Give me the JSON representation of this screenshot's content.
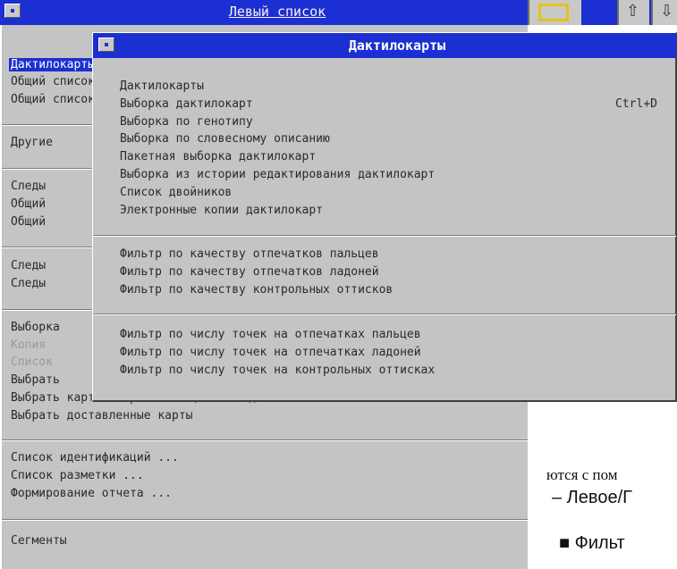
{
  "window": {
    "title": "Левый список"
  },
  "left_menu": {
    "items": [
      {
        "label": "Дактилокарты",
        "state": "selected"
      },
      {
        "label": "Общий список",
        "state": "normal"
      },
      {
        "label": "Общий список",
        "state": "normal"
      },
      {
        "label": "Другие",
        "state": "normal"
      },
      {
        "label": "Следы",
        "state": "normal"
      },
      {
        "label": "Общий",
        "state": "normal"
      },
      {
        "label": "Общий",
        "state": "normal"
      },
      {
        "label": "Следы",
        "state": "normal"
      },
      {
        "label": "Следы",
        "state": "normal"
      },
      {
        "label": "Выборка",
        "state": "normal"
      },
      {
        "label": "Копия",
        "state": "disabled"
      },
      {
        "label": "Список",
        "state": "disabled"
      },
      {
        "label": "Выбрать",
        "state": "normal"
      },
      {
        "label": "Выбрать карты отправленные, но не доставленные",
        "state": "normal"
      },
      {
        "label": "Выбрать доставленные карты",
        "state": "normal"
      },
      {
        "label": "Список идентификаций ...",
        "state": "normal"
      },
      {
        "label": "Список разметки ...",
        "state": "normal"
      },
      {
        "label": "Формирование отчета ...",
        "state": "normal"
      },
      {
        "label": "Сегменты",
        "state": "normal"
      }
    ]
  },
  "popup": {
    "title": "Дактилокарты",
    "items": [
      {
        "label": "Дактилокарты"
      },
      {
        "label": "Выборка дактилокарт",
        "shortcut": "Ctrl+D"
      },
      {
        "label": "Выборка по генотипу"
      },
      {
        "label": "Выборка по словесному описанию"
      },
      {
        "label": "Пакетная выборка дактилокарт"
      },
      {
        "label": "Выборка из истории редактирования дактилокарт"
      },
      {
        "label": "Список двойников"
      },
      {
        "label": "Электронные копии дактилокарт"
      },
      {
        "label": "Фильтр по качеству отпечатков пальцев"
      },
      {
        "label": "Фильтр по качеству отпечатков ладоней"
      },
      {
        "label": "Фильтр по качеству контрольных оттисков"
      },
      {
        "label": "Фильтр по числу точек на отпечатках пальцев"
      },
      {
        "label": "Фильтр по числу точек на отпечатках ладоней"
      },
      {
        "label": "Фильтр по числу точек на контрольных оттисках"
      }
    ]
  },
  "document_text": {
    "line1": "ются с пом",
    "line2": "– Левое/Г",
    "line3": "■ Фильт"
  },
  "colors": {
    "titlebar": "#1c2fd2",
    "menu_bg": "#c4c4c4",
    "highlight": "#e5c21a"
  },
  "icons": [
    "system-menu-icon",
    "toolbar-highlight-icon",
    "arrow-up-icon",
    "arrow-down-icon"
  ]
}
